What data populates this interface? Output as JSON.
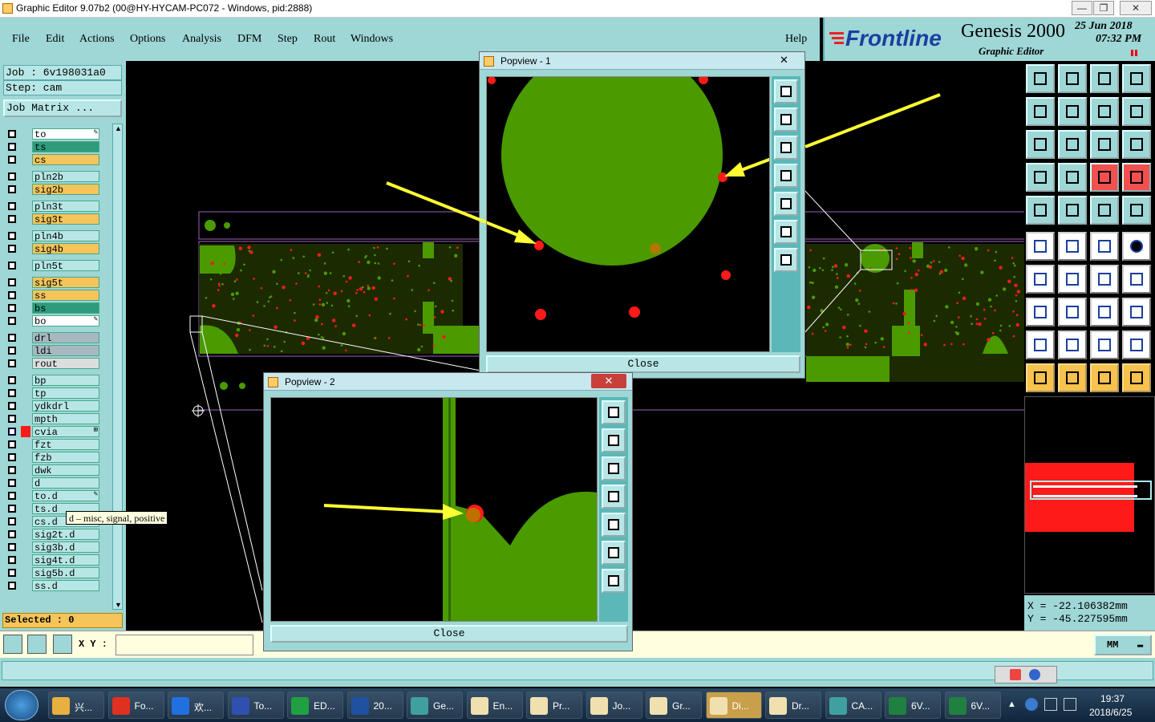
{
  "window": {
    "title": "Graphic Editor 9.07b2 (00@HY-HYCAM-PC072 - Windows, pid:2888)",
    "min": "—",
    "max": "❐",
    "close": "✕"
  },
  "menu": [
    "File",
    "Edit",
    "Actions",
    "Options",
    "Analysis",
    "DFM",
    "Step",
    "Rout",
    "Windows"
  ],
  "help": "Help",
  "logo": {
    "brand": "Frontline",
    "product": "Genesis 2000",
    "subtitle": "Graphic Editor",
    "date": "25 Jun 2018",
    "time": "07:32 PM"
  },
  "job": {
    "job_label": "Job : 6v198031a0",
    "step_label": "Step: cam",
    "matrix_btn": "Job Matrix ..."
  },
  "layers": [
    {
      "name": "to",
      "color": "#ffffff",
      "mark": "✎"
    },
    {
      "name": "ts",
      "color": "#2e9c7c",
      "mark": ""
    },
    {
      "name": "cs",
      "color": "#f5c45a",
      "mark": ""
    },
    {
      "name": "pln2b",
      "color": "#b8e6e6",
      "mark": ""
    },
    {
      "name": "sig2b",
      "color": "#f5c45a",
      "mark": ""
    },
    {
      "name": "pln3t",
      "color": "#b8e6e6",
      "mark": ""
    },
    {
      "name": "sig3t",
      "color": "#f5c45a",
      "mark": ""
    },
    {
      "name": "pln4b",
      "color": "#b8e6e6",
      "mark": ""
    },
    {
      "name": "sig4b",
      "color": "#f5c45a",
      "mark": ""
    },
    {
      "name": "pln5t",
      "color": "#b8e6e6",
      "mark": ""
    },
    {
      "name": "sig5t",
      "color": "#f5c45a",
      "mark": ""
    },
    {
      "name": "ss",
      "color": "#f5c45a",
      "mark": ""
    },
    {
      "name": "bs",
      "color": "#2e9c7c",
      "mark": ""
    },
    {
      "name": "bo",
      "color": "#ffffff",
      "mark": "✎"
    },
    {
      "name": "drl",
      "color": "#a8b8c0",
      "mark": ""
    },
    {
      "name": "ldi",
      "color": "#a8b8c0",
      "mark": ""
    },
    {
      "name": "rout",
      "color": "#dddddd",
      "mark": ""
    },
    {
      "name": "bp",
      "color": "#b8e6e6",
      "mark": ""
    },
    {
      "name": "tp",
      "color": "#b8e6e6",
      "mark": ""
    },
    {
      "name": "ydkdrl",
      "color": "#b8e6e6",
      "mark": ""
    },
    {
      "name": "mpth",
      "color": "#b8e6e6",
      "mark": ""
    },
    {
      "name": "cvia",
      "color": "#b8e6e6",
      "mark": "⊞"
    },
    {
      "name": "fzt",
      "color": "#b8e6e6",
      "mark": ""
    },
    {
      "name": "fzb",
      "color": "#b8e6e6",
      "mark": ""
    },
    {
      "name": "dwk",
      "color": "#b8e6e6",
      "mark": ""
    },
    {
      "name": "d",
      "color": "#b8e6e6",
      "mark": ""
    },
    {
      "name": "to.d",
      "color": "#b8e6e6",
      "mark": "✎"
    },
    {
      "name": "ts.d",
      "color": "#b8e6e6",
      "mark": ""
    },
    {
      "name": "cs.d",
      "color": "#b8e6e6",
      "mark": ""
    },
    {
      "name": "sig2t.d",
      "color": "#b8e6e6",
      "mark": ""
    },
    {
      "name": "sig3b.d",
      "color": "#b8e6e6",
      "mark": ""
    },
    {
      "name": "sig4t.d",
      "color": "#b8e6e6",
      "mark": ""
    },
    {
      "name": "sig5b.d",
      "color": "#b8e6e6",
      "mark": ""
    },
    {
      "name": "ss.d",
      "color": "#b8e6e6",
      "mark": ""
    }
  ],
  "tooltip": "d – misc, signal, positive",
  "selected": "Selected : 0",
  "popview1": {
    "title": "Popview - 1",
    "close": "Close"
  },
  "popview2": {
    "title": "Popview - 2",
    "close": "Close"
  },
  "coords": {
    "x": "X  = -22.106382mm",
    "y": "Y  = -45.227595mm"
  },
  "xy_label": "X Y :",
  "units": "MM",
  "taskbar": {
    "items": [
      "兴...",
      "Fo...",
      "欢...",
      "To...",
      "ED...",
      "20...",
      "Ge...",
      "En...",
      "Pr...",
      "Jo...",
      "Gr...",
      "Di...",
      "Dr...",
      "CA...",
      "6V...",
      "6V..."
    ],
    "clock_time": "19:37",
    "clock_date": "2018/6/25"
  },
  "colors": {
    "board_green": "#4a9a00",
    "pad_red": "#ff1a1a",
    "arrow_yellow": "#ffff33",
    "panel": "#9fd6d6"
  }
}
